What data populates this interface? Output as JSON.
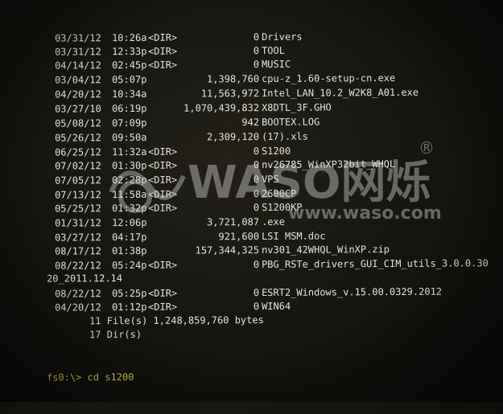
{
  "listing": [
    {
      "date": "03/31/12",
      "time": "10:26a",
      "dir": "<DIR>",
      "size": "0",
      "name": "Drivers"
    },
    {
      "date": "03/31/12",
      "time": "12:33p",
      "dir": "<DIR>",
      "size": "0",
      "name": "TOOL"
    },
    {
      "date": "04/14/12",
      "time": "02:45p",
      "dir": "<DIR>",
      "size": "0",
      "name": "MUSIC"
    },
    {
      "date": "03/04/12",
      "time": "05:07p",
      "dir": "",
      "size": "1,398,760",
      "name": "cpu-z_1.60-setup-cn.exe"
    },
    {
      "date": "04/20/12",
      "time": "10:34a",
      "dir": "",
      "size": "11,563,972",
      "name": "Intel_LAN_10.2_W2K8_A01.exe"
    },
    {
      "date": "03/27/10",
      "time": "06:19p",
      "dir": "",
      "size": "1,070,439,832",
      "name": "X8DTL_3F.GHO"
    },
    {
      "date": "05/08/12",
      "time": "07:09p",
      "dir": "",
      "size": "942",
      "name": "BOOTEX.LOG"
    },
    {
      "date": "05/26/12",
      "time": "09:50a",
      "dir": "",
      "size": "2,309,120",
      "name": "(17).xls"
    },
    {
      "date": "06/25/12",
      "time": "11:32a",
      "dir": "<DIR>",
      "size": "0",
      "name": "S1200"
    },
    {
      "date": "07/02/12",
      "time": "01:30p",
      "dir": "<DIR>",
      "size": "0",
      "name": "nv26785_WinXP32bit_WHQL"
    },
    {
      "date": "07/05/12",
      "time": "02:28p",
      "dir": "<DIR>",
      "size": "0",
      "name": "VPS"
    },
    {
      "date": "07/13/12",
      "time": "11:58a",
      "dir": "<DIR>",
      "size": "0",
      "name": "2600CP"
    },
    {
      "date": "05/25/12",
      "time": "01:32p",
      "dir": "<DIR>",
      "size": "0",
      "name": "S1200KP"
    },
    {
      "date": "01/31/12",
      "time": "12:06p",
      "dir": "",
      "size": "3,721,087",
      "name": ".exe"
    },
    {
      "date": "03/27/12",
      "time": "04:17p",
      "dir": "",
      "size": "921,600",
      "name": "LSI MSM.doc"
    },
    {
      "date": "08/17/12",
      "time": "01:38p",
      "dir": "",
      "size": "157,344,325",
      "name": "nv301_42WHQL_WinXP.zip"
    },
    {
      "date": "08/22/12",
      "time": "05:24p",
      "dir": "<DIR>",
      "size": "0",
      "name": "PBG_RSTe_drivers_GUI_CIM_utils_3.0.0.30"
    }
  ],
  "wrap_line": "20_2011.12.14",
  "listing_tail": [
    {
      "date": "08/22/12",
      "time": "05:25p",
      "dir": "<DIR>",
      "size": "0",
      "name": "ESRT2_Windows_v.15.00.0329.2012"
    },
    {
      "date": "04/20/12",
      "time": "01:12p",
      "dir": "<DIR>",
      "size": "0",
      "name": "WIN64"
    }
  ],
  "summary": {
    "files": "11 File(s) 1,248,859,760 bytes",
    "dirs": "17 Dir(s)"
  },
  "prompt": "fs0:\\> cd s1200",
  "watermark": {
    "brand": "WASO网烁",
    "url": "www.waso.com.cn",
    "registered": "®"
  },
  "colors": {
    "text": "#e6e4da",
    "prompt": "#e8d445",
    "background": "#141410"
  }
}
